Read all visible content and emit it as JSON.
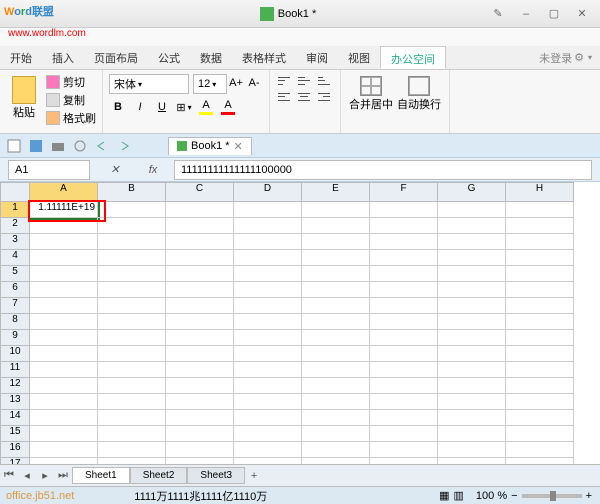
{
  "title": "Book1 *",
  "url_watermark": "www.wordlm.com",
  "brand_watermark": {
    "w": "W",
    "o": "o",
    "r": "r",
    "d": "d",
    "rest": "联盟"
  },
  "ribbon_tabs": [
    "开始",
    "插入",
    "页面布局",
    "公式",
    "数据",
    "表格样式",
    "审阅",
    "视图",
    "办公空间"
  ],
  "login_text": "未登录",
  "clipboard": {
    "paste": "粘贴",
    "cut": "剪切",
    "copy": "复制",
    "fmt": "格式刷"
  },
  "font": {
    "name": "宋体",
    "size": "12"
  },
  "alignment": {
    "merge": "合并居中",
    "wrap": "自动换行"
  },
  "doc_tab": "Book1 *",
  "namebox": "A1",
  "formula_value": "11111111111111100000",
  "columns": [
    "A",
    "B",
    "C",
    "D",
    "E",
    "F",
    "G",
    "H"
  ],
  "rows": [
    "1",
    "2",
    "3",
    "4",
    "5",
    "6",
    "7",
    "8",
    "9",
    "10",
    "11",
    "12",
    "13",
    "14",
    "15",
    "16",
    "17"
  ],
  "cell_a1": "1.11111E+19",
  "sheets": [
    "Sheet1",
    "Sheet2",
    "Sheet3"
  ],
  "status_left": "office.jb51.net",
  "status_center": "1111万1111兆1111亿1110万",
  "zoom": "100 %"
}
